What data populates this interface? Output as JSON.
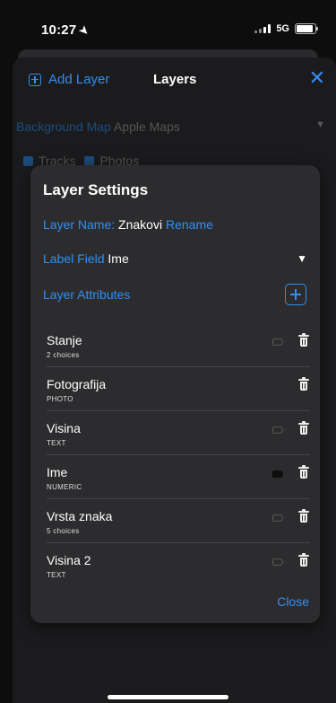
{
  "status": {
    "time": "10:27",
    "network": "5G"
  },
  "sheet": {
    "add_layer_label": "Add Layer",
    "title": "Layers",
    "close_icon": "close-icon",
    "background_map_label": "Background Map",
    "background_map_value": "Apple Maps",
    "tracks_label": "Tracks",
    "photos_label": "Photos"
  },
  "settings": {
    "title": "Layer Settings",
    "layer_name_label": "Layer Name:",
    "layer_name_value": "Znakovi",
    "rename_label": "Rename",
    "label_field_label": "Label Field",
    "label_field_value": "Ime",
    "attributes_title": "Layer Attributes",
    "attributes": [
      {
        "name": "Stanje",
        "type": "2 choices",
        "label_tag": true,
        "label_active": false
      },
      {
        "name": "Fotografija",
        "type": "PHOTO",
        "label_tag": false,
        "label_active": false
      },
      {
        "name": "Visina",
        "type": "TEXT",
        "label_tag": true,
        "label_active": false
      },
      {
        "name": "Ime",
        "type": "NUMERIC",
        "label_tag": true,
        "label_active": true
      },
      {
        "name": "Vrsta znaka",
        "type": "5 choices",
        "label_tag": true,
        "label_active": false
      },
      {
        "name": "Visina 2",
        "type": "TEXT",
        "label_tag": true,
        "label_active": false
      }
    ],
    "close_label": "Close"
  },
  "colors": {
    "accent": "#2f8ff5",
    "panel": "#2c2c2e",
    "sheet": "#1b1b1d"
  }
}
